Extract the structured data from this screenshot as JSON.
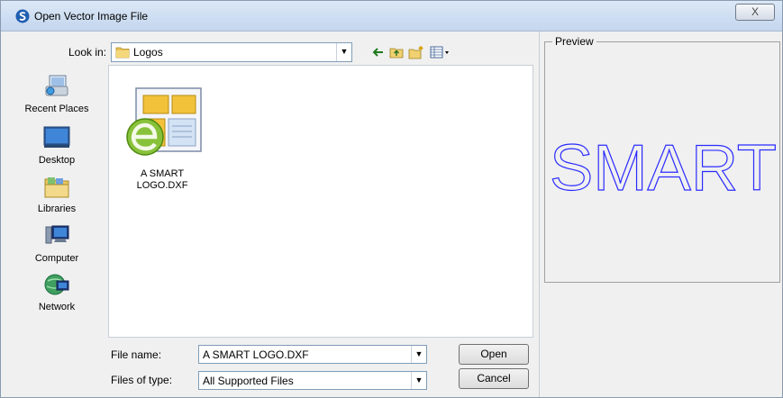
{
  "window": {
    "title": "Open Vector Image File",
    "close_label": "X"
  },
  "look_in": {
    "label": "Look in:",
    "value": "Logos"
  },
  "toolbar": {
    "back_icon": "back-arrow-icon",
    "up_icon": "up-folder-icon",
    "new_folder_icon": "new-folder-icon",
    "view_menu_icon": "view-menu-icon"
  },
  "places": [
    {
      "label": "Recent Places",
      "icon": "recent-places-icon"
    },
    {
      "label": "Desktop",
      "icon": "desktop-icon"
    },
    {
      "label": "Libraries",
      "icon": "libraries-icon"
    },
    {
      "label": "Computer",
      "icon": "computer-icon"
    },
    {
      "label": "Network",
      "icon": "network-icon"
    }
  ],
  "files": [
    {
      "name_line1": "A SMART",
      "name_line2": "LOGO.DXF",
      "icon": "dxf-file-icon"
    }
  ],
  "file_name": {
    "label": "File name:",
    "value": "A SMART LOGO.DXF"
  },
  "file_type": {
    "label": "Files of type:",
    "value": "All Supported Files"
  },
  "buttons": {
    "open": "Open",
    "cancel": "Cancel"
  },
  "preview": {
    "label": "Preview",
    "text": "SMART",
    "stroke_color": "#2b2bff"
  }
}
